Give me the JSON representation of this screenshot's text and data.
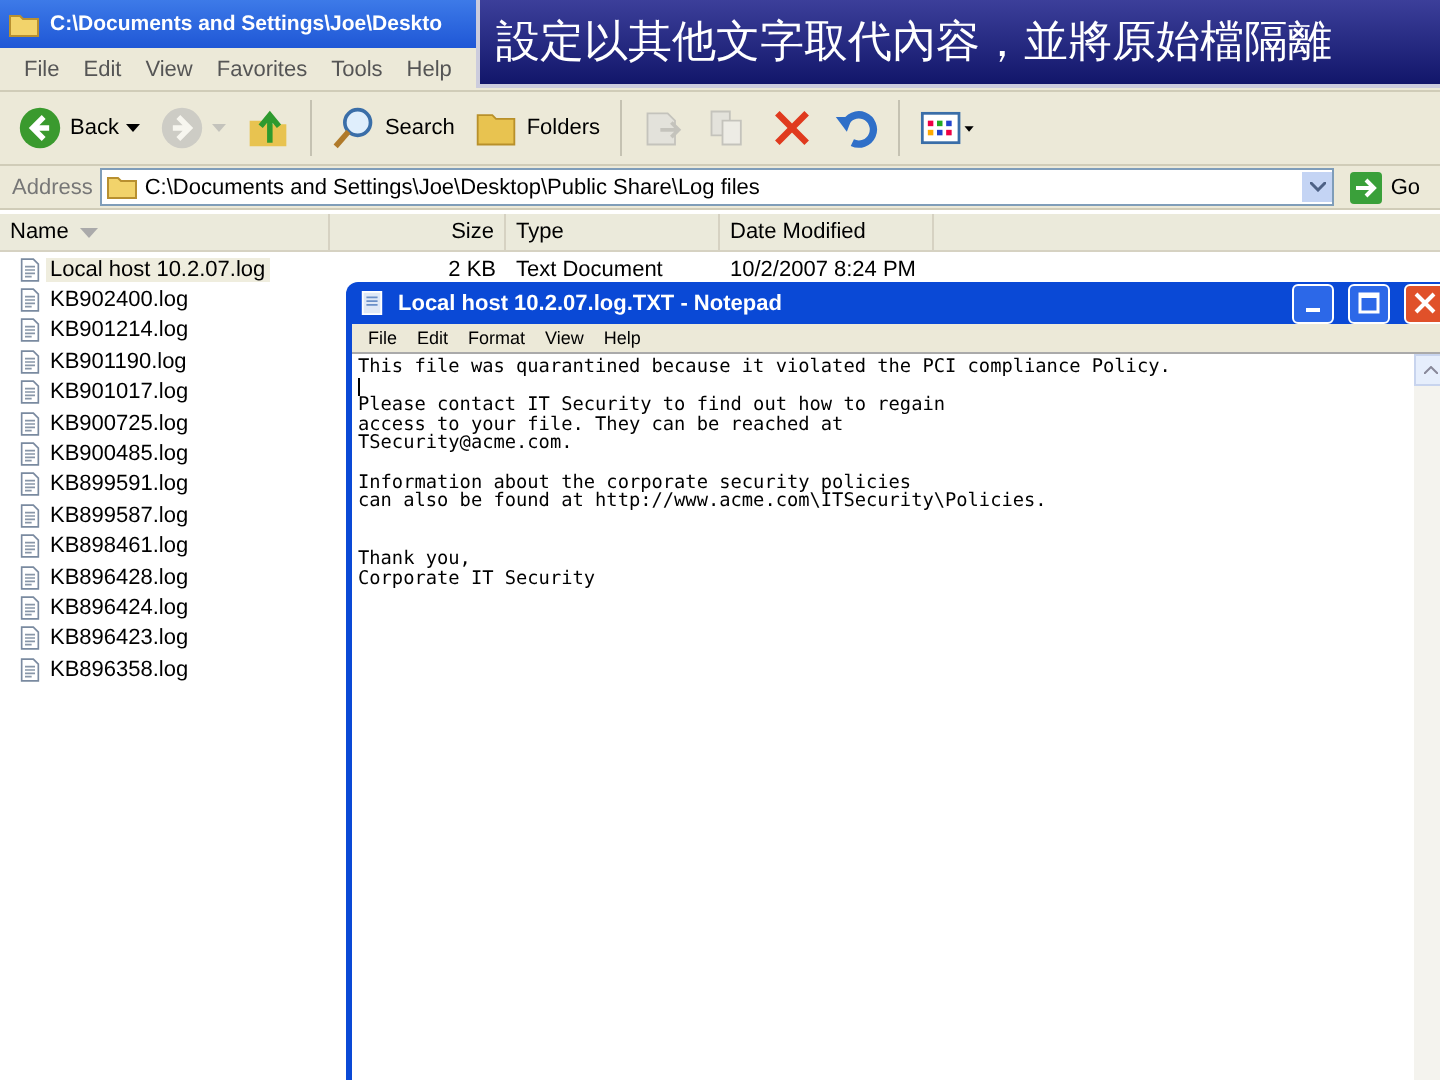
{
  "explorer": {
    "title": "C:\\Documents and Settings\\Joe\\Deskto",
    "menu": [
      "File",
      "Edit",
      "View",
      "Favorites",
      "Tools",
      "Help"
    ],
    "toolbar": [
      {
        "kind": "back",
        "label": "Back",
        "disabled": false
      },
      {
        "kind": "forward",
        "disabled": true
      },
      {
        "kind": "up",
        "disabled": false
      },
      {
        "kind": "search",
        "label": "Search",
        "disabled": false
      },
      {
        "kind": "folders",
        "label": "Folders",
        "disabled": false
      },
      {
        "kind": "move",
        "disabled": true
      },
      {
        "kind": "copy",
        "disabled": true
      },
      {
        "kind": "delete",
        "disabled": false
      },
      {
        "kind": "undo",
        "disabled": false
      },
      {
        "kind": "views",
        "disabled": false
      }
    ],
    "address": {
      "label": "Address",
      "value": "C:\\Documents and Settings\\Joe\\Desktop\\Public Share\\Log files",
      "go": "Go"
    },
    "columns": [
      "Name",
      "Size",
      "Type",
      "Date Modified"
    ],
    "files": [
      {
        "name": "Local host 10.2.07.log",
        "size": "2 KB",
        "type": "Text Document",
        "modified": "10/2/2007 8:24 PM",
        "selected": true
      },
      {
        "name": "KB902400.log",
        "selected": false
      },
      {
        "name": "KB901214.log",
        "selected": false
      },
      {
        "name": "KB901190.log",
        "selected": false
      },
      {
        "name": "KB901017.log",
        "selected": false
      },
      {
        "name": "KB900725.log",
        "selected": false
      },
      {
        "name": "KB900485.log",
        "selected": false
      },
      {
        "name": "KB899591.log",
        "selected": false
      },
      {
        "name": "KB899587.log",
        "selected": false
      },
      {
        "name": "KB898461.log",
        "selected": false
      },
      {
        "name": "KB896428.log",
        "selected": false
      },
      {
        "name": "KB896424.log",
        "selected": false
      },
      {
        "name": "KB896423.log",
        "selected": false
      },
      {
        "name": "KB896358.log",
        "selected": false
      }
    ]
  },
  "notepad": {
    "title": "Local host 10.2.07.log.TXT - Notepad",
    "menu": [
      "File",
      "Edit",
      "Format",
      "View",
      "Help"
    ],
    "paragraphs": [
      [
        "This file was quarantined because it violated the PCI compliance Policy."
      ],
      [
        "Please contact IT Security to find out how to regain",
        "access to your file. They can be reached at",
        "TSecurity@acme.com."
      ],
      [
        "Information about the corporate security policies",
        "can also be found at http://www.acme.com\\ITSecurity\\Policies."
      ],
      [
        "Thank you,",
        "Corporate IT Security"
      ]
    ]
  },
  "caption": "設定以其他文字取代內容，並將原始檔隔離"
}
